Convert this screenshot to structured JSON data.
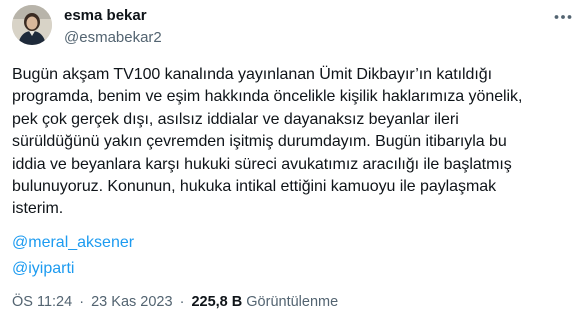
{
  "author": {
    "display_name": "esma bekar",
    "handle": "@esmabekar2"
  },
  "tweet": {
    "lines": [
      "Bugün akşam TV100 kanalında yayınlanan Ümit Dikbayır’ın katıldığı",
      "programda, benim ve eşim hakkında öncelikle kişilik haklarımıza yönelik,",
      "pek çok gerçek dışı, asılsız iddialar ve dayanaksız beyanlar ileri",
      "sürüldüğünü yakın çevremden işitmiş durumdayım. Bugün itibarıyla bu",
      "iddia ve beyanlara karşı hukuki süreci avukatımız aracılığı ile başlatmış",
      "bulunuyoruz. Konunun, hukuka intikal ettiğini kamuoyu ile paylaşmak",
      "isterim."
    ],
    "mentions": [
      "@meral_aksener",
      "@iyiparti"
    ]
  },
  "meta": {
    "time": "ÖS 11:24",
    "date": "23 Kas 2023",
    "separator": "·",
    "views_count": "225,8 B",
    "views_label": "Görüntülenme"
  },
  "icons": {
    "more": "more-horizontal-icon",
    "avatar": "profile-photo"
  },
  "colors": {
    "link": "#1d9bf0",
    "secondary_text": "#536471",
    "primary_text": "#0f1419"
  }
}
